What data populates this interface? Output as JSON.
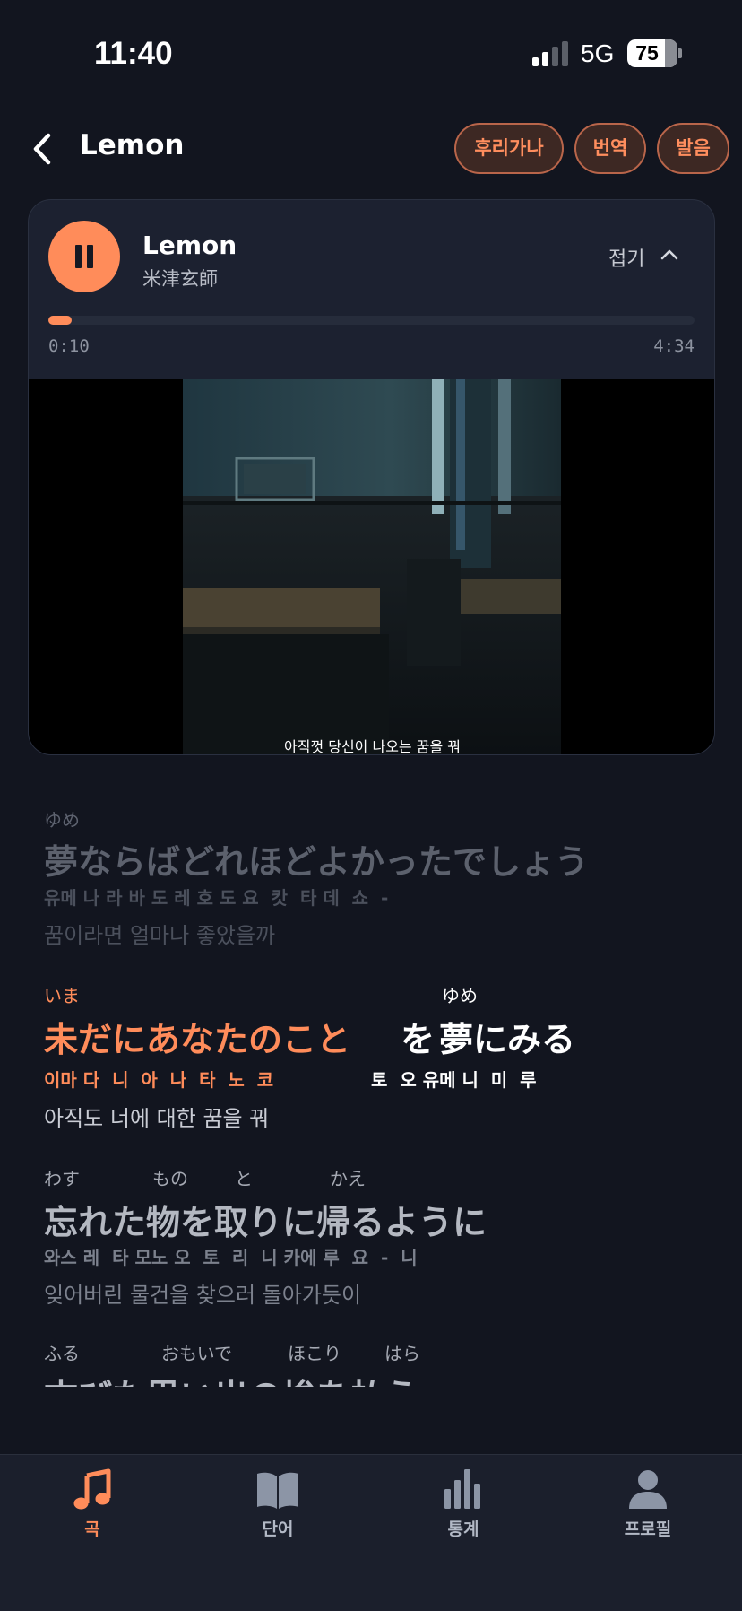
{
  "status": {
    "time": "11:40",
    "network": "5G",
    "battery": "75"
  },
  "header": {
    "title": "Lemon",
    "chips": [
      "후리가나",
      "번역",
      "발음"
    ]
  },
  "player": {
    "title": "Lemon",
    "artist": "米津玄師",
    "collapse_label": "접기",
    "current_time": "0:10",
    "total_time": "4:34",
    "progress": 0.036,
    "subtitle": "아직껏 당신이 나오는 꿈을 꿔"
  },
  "lyrics": [
    {
      "state": "past",
      "ruby": [
        "ゆめ"
      ],
      "text": [
        "夢ならばどれほどよかったでしょう"
      ],
      "pron": [
        "유메 나 라 바 도 레 호 도 요  캇  타 데  쇼  -"
      ],
      "translation": "꿈이라면 얼마나 좋았을까"
    },
    {
      "state": "current",
      "ruby": [
        "いま",
        "ゆめ"
      ],
      "text_sung": "未だにあなたのこと",
      "text_rest_a": "を",
      "text_rest_b": "夢にみる",
      "pron_sung": "이마 다  니  아  나  타  노  코",
      "pron_rest": "토  오 유메 니  미  루",
      "translation": "아직도 너에 대한 꿈을 꿔"
    },
    {
      "state": "upcoming",
      "ruby": [
        "わす",
        "もの",
        "と",
        "かえ"
      ],
      "text": [
        "忘れた物を取りに帰るように"
      ],
      "pron": [
        "와스 레  타 모노 오  토  리  니 카에 루  요  -  니"
      ],
      "translation": "잊어버린 물건을 찾으러 돌아가듯이"
    },
    {
      "state": "upcoming",
      "ruby": [
        "ふる",
        "おもいで",
        "ほこり",
        "はら"
      ],
      "text": [
        "古びた思い出の埃を払う"
      ]
    }
  ],
  "nav": [
    {
      "label": "곡",
      "icon": "music-note-icon",
      "active": true
    },
    {
      "label": "단어",
      "icon": "book-icon",
      "active": false
    },
    {
      "label": "통계",
      "icon": "bar-chart-icon",
      "active": false
    },
    {
      "label": "프로필",
      "icon": "person-icon",
      "active": false
    }
  ],
  "colors": {
    "accent": "#ff8c5a",
    "background": "#12151f",
    "card": "#1c2130"
  }
}
